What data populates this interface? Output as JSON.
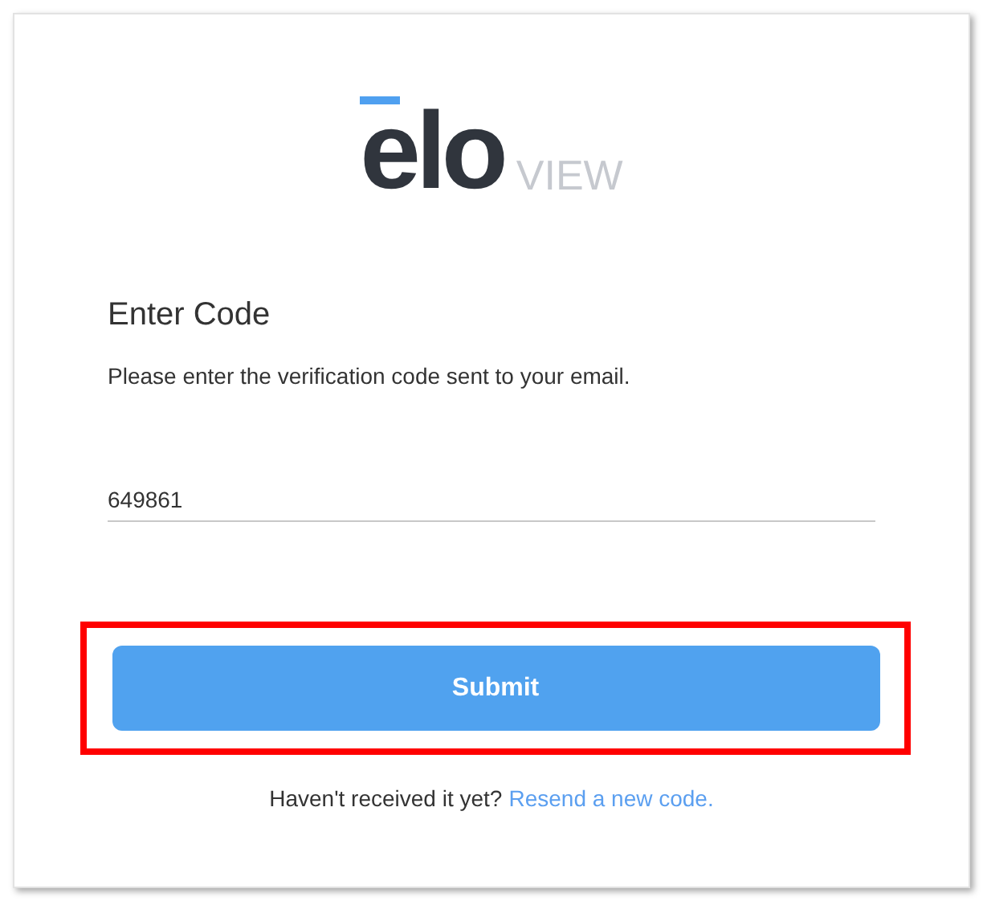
{
  "logo": {
    "wordmark": "elo",
    "product": "VIEW"
  },
  "heading": "Enter Code",
  "instructions": "Please enter the verification code sent to your email.",
  "code_field": {
    "value": "649861"
  },
  "submit_button": {
    "label": "Submit",
    "highlighted": true
  },
  "resend": {
    "prompt": "Haven't received it yet?",
    "link": "Resend a new code."
  }
}
